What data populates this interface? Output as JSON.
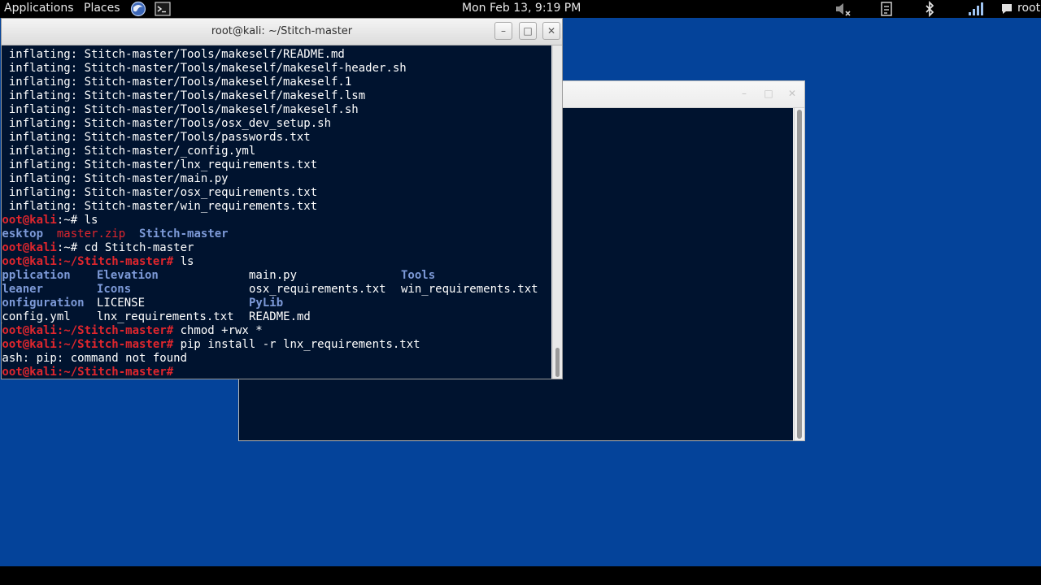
{
  "top_panel": {
    "applications": "Applications",
    "places": "Places",
    "clock": "Mon Feb 13,  9:19 PM",
    "user": "root",
    "icons": [
      "browser-icon",
      "terminal-launcher-icon",
      "volume-muted-icon",
      "clipboard-icon",
      "bluetooth-icon",
      "network-signal-icon",
      "chat-icon"
    ]
  },
  "terminal": {
    "title": "root@kali: ~/Stitch-master",
    "prompt_user": "root@kali",
    "inflating": [
      "  inflating: Stitch-master/Tools/makeself/README.md",
      "  inflating: Stitch-master/Tools/makeself/makeself-header.sh",
      "  inflating: Stitch-master/Tools/makeself/makeself.1",
      "  inflating: Stitch-master/Tools/makeself/makeself.lsm",
      "  inflating: Stitch-master/Tools/makeself/makeself.sh",
      "  inflating: Stitch-master/Tools/osx_dev_setup.sh",
      "  inflating: Stitch-master/Tools/passwords.txt",
      "  inflating: Stitch-master/_config.yml",
      "  inflating: Stitch-master/lnx_requirements.txt",
      "  inflating: Stitch-master/main.py",
      "  inflating: Stitch-master/osx_requirements.txt",
      "  inflating: Stitch-master/win_requirements.txt"
    ],
    "p1": {
      "prompt": "root@kali",
      "path": ":~# ",
      "cmd": "ls"
    },
    "ls1": {
      "desktop": "Desktop",
      "zip": "master.zip",
      "stitch": "Stitch-master"
    },
    "p2": {
      "prompt": "root@kali",
      "path": ":~# ",
      "cmd": "cd Stitch-master"
    },
    "p3": {
      "prompt": "root@kali",
      "path": ":~/Stitch-master# ",
      "cmd": "ls"
    },
    "ls2": {
      "r1": [
        "Application",
        "Elevation",
        "main.py",
        "Tools"
      ],
      "r2": [
        "Cleaner",
        "Icons",
        "osx_requirements.txt",
        "win_requirements.txt"
      ],
      "r3": [
        "Configuration",
        "LICENSE",
        "PyLib",
        ""
      ],
      "r4": [
        "_config.yml",
        "lnx_requirements.txt",
        "README.md",
        ""
      ]
    },
    "p4": {
      "prompt": "root@kali",
      "path": ":~/Stitch-master# ",
      "cmd": "chmod +rwx *"
    },
    "p5": {
      "prompt": "root@kali",
      "path": ":~/Stitch-master# ",
      "cmd": "pip install -r lnx_requirements.txt"
    },
    "error": "bash: pip: command not found",
    "p6": {
      "prompt": "root@kali",
      "path": ":~/Stitch-master# ",
      "cmd": ""
    }
  },
  "colors": {
    "desktop": "#04439a",
    "terminal_bg": "#00132f",
    "prompt_red": "#e0262d",
    "dir_blue": "#7d9ad8"
  }
}
